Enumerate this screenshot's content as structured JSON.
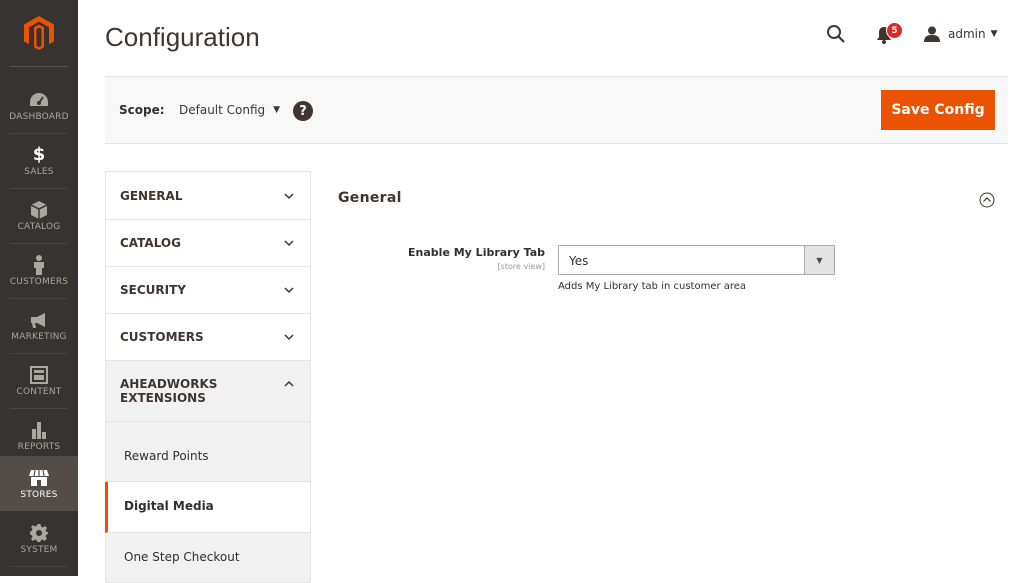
{
  "page": {
    "title": "Configuration"
  },
  "header": {
    "notification_count": "5",
    "user_name": "admin"
  },
  "menu": [
    {
      "label": "DASHBOARD",
      "icon": "dashboard-icon"
    },
    {
      "label": "SALES",
      "icon": "dollar-icon"
    },
    {
      "label": "CATALOG",
      "icon": "box-icon"
    },
    {
      "label": "CUSTOMERS",
      "icon": "person-icon"
    },
    {
      "label": "MARKETING",
      "icon": "megaphone-icon"
    },
    {
      "label": "CONTENT",
      "icon": "layout-icon"
    },
    {
      "label": "REPORTS",
      "icon": "bar-chart-icon"
    },
    {
      "label": "STORES",
      "icon": "store-icon",
      "active": true
    },
    {
      "label": "SYSTEM",
      "icon": "gear-icon"
    }
  ],
  "scope": {
    "label": "Scope:",
    "value": "Default Config",
    "save_label": "Save Config"
  },
  "tabs": [
    {
      "title": "GENERAL"
    },
    {
      "title": "CATALOG"
    },
    {
      "title": "SECURITY"
    },
    {
      "title": "CUSTOMERS"
    },
    {
      "title": "AHEADWORKS EXTENSIONS",
      "open": true
    }
  ],
  "subtabs": [
    {
      "label": "Reward Points"
    },
    {
      "label": "Digital Media",
      "active": true
    },
    {
      "label": "One Step Checkout"
    }
  ],
  "section": {
    "title": "General",
    "field_label": "Enable My Library Tab",
    "field_scope": "[store view]",
    "field_value": "Yes",
    "field_note": "Adds My Library tab in customer area"
  },
  "colors": {
    "accent": "#eb5202",
    "menu_bg": "#373330",
    "badge": "#e22626"
  }
}
